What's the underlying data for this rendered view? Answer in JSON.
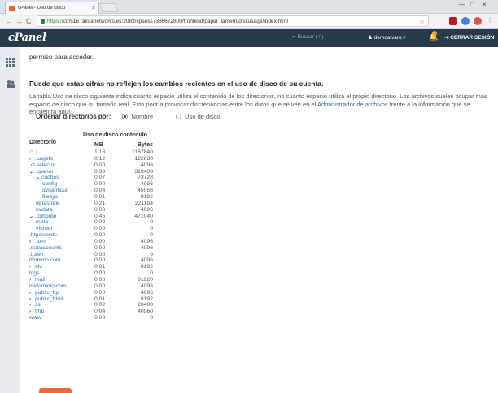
{
  "browser": {
    "tab_title": "cPanel - Uso de disco",
    "tab_close": "×",
    "url_scheme": "https://",
    "url_rest": "com16.raiolanetworks.es:2083/cpsess7386672800/frontend/paper_lantern/diskusage/index.html",
    "win_min": "—",
    "win_max": "□",
    "win_close": "×",
    "back": "←",
    "forward": "→",
    "reload": "C",
    "star": "☆",
    "menu": "⋮"
  },
  "header": {
    "logo": "cPanel",
    "search_placeholder": "Buscar ( / )",
    "user": "demoalvaro",
    "user_caret": "▾",
    "logout": "CERRAR SESIÓN"
  },
  "content": {
    "top_cut": "permiso para acceder.",
    "heading": "Puede que estas cifras no reflejen los cambios recientes en el uso de disco de su cuenta.",
    "desc_part1": "La tabla Uso de disco siguiente indica cuánto espacio utiliza el contenido de los directorios, no cuánto espacio utiliza el propio directorio. Los archivos suelen ocupar más espacio de disco que su tamaño real. Esto podría provocar discrepancias entre los datos que se ven en el ",
    "desc_link": "Administrador de archivos",
    "desc_part2": " frente a la información que se encuentra aquí.",
    "order_label": "Ordenar directorios por:",
    "order_options": [
      "Nombre",
      "Uso de disco"
    ]
  },
  "table": {
    "group_header": "Uso de disco contenido",
    "col_dir": "Directorio",
    "col_mb": "MB",
    "col_bytes": "Bytes",
    "rows": [
      {
        "name": "/",
        "level": 0,
        "arrow": "",
        "home": true,
        "mb": "1.13",
        "bytes": "1187840"
      },
      {
        "name": ".cagefs",
        "level": 0,
        "arrow": "›",
        "mb": "0.12",
        "bytes": "122880"
      },
      {
        "name": ".cl.selector",
        "level": 0,
        "arrow": "",
        "mb": "0.00",
        "bytes": "4096"
      },
      {
        "name": ".cpanel",
        "level": 0,
        "arrow": "⌄",
        "mb": "0.30",
        "bytes": "319488"
      },
      {
        "name": "caches",
        "level": 1,
        "arrow": "⌄",
        "mb": "0.07",
        "bytes": "73728"
      },
      {
        "name": "config",
        "level": 2,
        "arrow": "",
        "mb": "0.00",
        "bytes": "4096"
      },
      {
        "name": "dynamicui",
        "level": 2,
        "arrow": "",
        "mb": "0.04",
        "bytes": "45056"
      },
      {
        "name": "filesys",
        "level": 2,
        "arrow": "",
        "mb": "0.01",
        "bytes": "8192"
      },
      {
        "name": "datastore",
        "level": 1,
        "arrow": "",
        "mb": "0.21",
        "bytes": "221184"
      },
      {
        "name": "nvdata",
        "level": 1,
        "arrow": "",
        "mb": "0.00",
        "bytes": "4096"
      },
      {
        "name": ".cphorde",
        "level": 0,
        "arrow": "⌄",
        "mb": "0.45",
        "bytes": "471040"
      },
      {
        "name": "meta",
        "level": 1,
        "arrow": "",
        "mb": "0.00",
        "bytes": "0"
      },
      {
        "name": "vfsroot",
        "level": 1,
        "arrow": "",
        "mb": "0.00",
        "bytes": "0"
      },
      {
        "name": ".htpasswds",
        "level": 0,
        "arrow": "",
        "mb": "0.00",
        "bytes": "0"
      },
      {
        "name": ".jbm",
        "level": 0,
        "arrow": "›",
        "mb": "0.00",
        "bytes": "4096"
      },
      {
        "name": ".subaccounts",
        "level": 0,
        "arrow": "",
        "mb": "0.00",
        "bytes": "4096"
      },
      {
        "name": ".trash",
        "level": 0,
        "arrow": "",
        "mb": "0.00",
        "bytes": "0"
      },
      {
        "name": "dominio.com",
        "level": 0,
        "arrow": "",
        "mb": "0.00",
        "bytes": "4096"
      },
      {
        "name": "etc",
        "level": 0,
        "arrow": "›",
        "mb": "0.01",
        "bytes": "8192"
      },
      {
        "name": "logs",
        "level": 0,
        "arrow": "",
        "mb": "0.00",
        "bytes": "0"
      },
      {
        "name": "mail",
        "level": 0,
        "arrow": "›",
        "mb": "0.08",
        "bytes": "81920"
      },
      {
        "name": "midominio.com",
        "level": 0,
        "arrow": "",
        "mb": "0.00",
        "bytes": "4096"
      },
      {
        "name": "public_ftp",
        "level": 0,
        "arrow": "›",
        "mb": "0.00",
        "bytes": "4096"
      },
      {
        "name": "public_html",
        "level": 0,
        "arrow": "›",
        "mb": "0.01",
        "bytes": "8192"
      },
      {
        "name": "ssl",
        "level": 0,
        "arrow": "›",
        "mb": "0.02",
        "bytes": "20480"
      },
      {
        "name": "tmp",
        "level": 0,
        "arrow": "›",
        "mb": "0.04",
        "bytes": "40960"
      },
      {
        "name": "www",
        "level": 0,
        "arrow": "",
        "mb": "0.00",
        "bytes": "0"
      }
    ]
  },
  "colors": {
    "header_bg": "#293a4a",
    "link": "#2a6ebb",
    "accent": "#f1673c"
  }
}
